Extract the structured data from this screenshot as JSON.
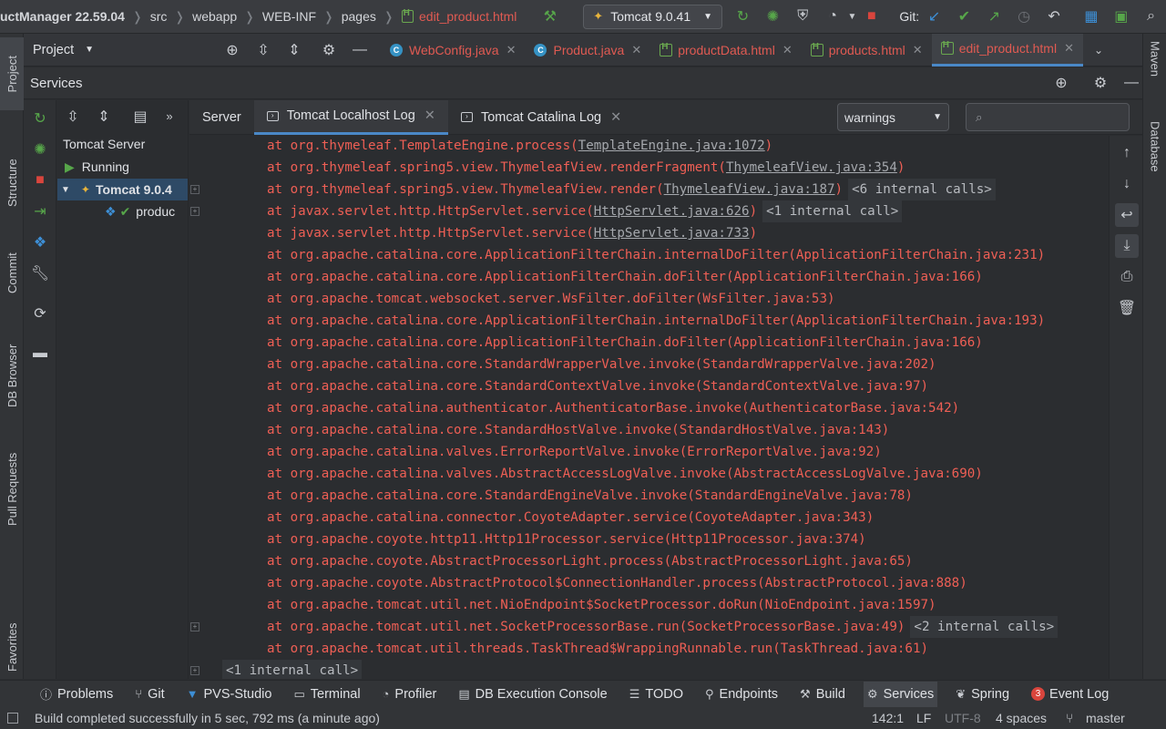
{
  "navbar": {
    "project": "uctManager 22.59.04",
    "crumbs": [
      "src",
      "webapp",
      "WEB-INF",
      "pages"
    ],
    "file": "edit_product.html",
    "run_config": "Tomcat 9.0.41",
    "git_label": "Git:"
  },
  "left_strip": {
    "project": "Project",
    "structure": "Structure",
    "commit": "Commit",
    "db_browser": "DB Browser",
    "pull_requests": "Pull Requests",
    "favorites": "Favorites"
  },
  "right_strip": {
    "maven": "Maven",
    "database": "Database"
  },
  "project_combo": "Project",
  "editor_tabs": [
    {
      "label": "WebConfig.java",
      "type": "java"
    },
    {
      "label": "Product.java",
      "type": "java"
    },
    {
      "label": "productData.html",
      "type": "html"
    },
    {
      "label": "products.html",
      "type": "html"
    },
    {
      "label": "edit_product.html",
      "type": "html"
    }
  ],
  "services": {
    "title": "Services",
    "tree": {
      "group": "Tomcat Server",
      "status": "Running",
      "server": "Tomcat 9.0.4",
      "artifact": "produc"
    },
    "log_tabs": [
      "Server",
      "Tomcat Localhost Log",
      "Tomcat Catalina Log"
    ],
    "filter": "warnings",
    "search_placeholder": ""
  },
  "console": {
    "lines": [
      {
        "pre": "at org.thymeleaf.TemplateEngine.process(",
        "link": "TemplateEngine.java:1072",
        "post": ")",
        "hint": ""
      },
      {
        "pre": "at org.thymeleaf.spring5.view.ThymeleafView.renderFragment(",
        "link": "ThymeleafView.java:354",
        "post": ")",
        "hint": ""
      },
      {
        "pre": "at org.thymeleaf.spring5.view.ThymeleafView.render(",
        "link": "ThymeleafView.java:187",
        "post": ")",
        "hint": "<6 internal calls>"
      },
      {
        "pre": "at javax.servlet.http.HttpServlet.service(",
        "link": "HttpServlet.java:626",
        "post": ")",
        "hint": "<1 internal call>"
      },
      {
        "pre": "at javax.servlet.http.HttpServlet.service(",
        "link": "HttpServlet.java:733",
        "post": ")",
        "hint": ""
      },
      {
        "pre": "at org.apache.catalina.core.ApplicationFilterChain.internalDoFilter(ApplicationFilterChain.java:231)",
        "link": "",
        "post": "",
        "hint": ""
      },
      {
        "pre": "at org.apache.catalina.core.ApplicationFilterChain.doFilter(ApplicationFilterChain.java:166)",
        "link": "",
        "post": "",
        "hint": ""
      },
      {
        "pre": "at org.apache.tomcat.websocket.server.WsFilter.doFilter(WsFilter.java:53)",
        "link": "",
        "post": "",
        "hint": ""
      },
      {
        "pre": "at org.apache.catalina.core.ApplicationFilterChain.internalDoFilter(ApplicationFilterChain.java:193)",
        "link": "",
        "post": "",
        "hint": ""
      },
      {
        "pre": "at org.apache.catalina.core.ApplicationFilterChain.doFilter(ApplicationFilterChain.java:166)",
        "link": "",
        "post": "",
        "hint": ""
      },
      {
        "pre": "at org.apache.catalina.core.StandardWrapperValve.invoke(StandardWrapperValve.java:202)",
        "link": "",
        "post": "",
        "hint": ""
      },
      {
        "pre": "at org.apache.catalina.core.StandardContextValve.invoke(StandardContextValve.java:97)",
        "link": "",
        "post": "",
        "hint": ""
      },
      {
        "pre": "at org.apache.catalina.authenticator.AuthenticatorBase.invoke(AuthenticatorBase.java:542)",
        "link": "",
        "post": "",
        "hint": ""
      },
      {
        "pre": "at org.apache.catalina.core.StandardHostValve.invoke(StandardHostValve.java:143)",
        "link": "",
        "post": "",
        "hint": ""
      },
      {
        "pre": "at org.apache.catalina.valves.ErrorReportValve.invoke(ErrorReportValve.java:92)",
        "link": "",
        "post": "",
        "hint": ""
      },
      {
        "pre": "at org.apache.catalina.valves.AbstractAccessLogValve.invoke(AbstractAccessLogValve.java:690)",
        "link": "",
        "post": "",
        "hint": ""
      },
      {
        "pre": "at org.apache.catalina.core.StandardEngineValve.invoke(StandardEngineValve.java:78)",
        "link": "",
        "post": "",
        "hint": ""
      },
      {
        "pre": "at org.apache.catalina.connector.CoyoteAdapter.service(CoyoteAdapter.java:343)",
        "link": "",
        "post": "",
        "hint": ""
      },
      {
        "pre": "at org.apache.coyote.http11.Http11Processor.service(Http11Processor.java:374)",
        "link": "",
        "post": "",
        "hint": ""
      },
      {
        "pre": "at org.apache.coyote.AbstractProcessorLight.process(AbstractProcessorLight.java:65)",
        "link": "",
        "post": "",
        "hint": ""
      },
      {
        "pre": "at org.apache.coyote.AbstractProtocol$ConnectionHandler.process(AbstractProtocol.java:888)",
        "link": "",
        "post": "",
        "hint": ""
      },
      {
        "pre": "at org.apache.tomcat.util.net.NioEndpoint$SocketProcessor.doRun(NioEndpoint.java:1597)",
        "link": "",
        "post": "",
        "hint": ""
      },
      {
        "pre": "at org.apache.tomcat.util.net.SocketProcessorBase.run(SocketProcessorBase.java:49)",
        "link": "",
        "post": "",
        "hint": "<2 internal calls>"
      },
      {
        "pre": "at org.apache.tomcat.util.threads.TaskThread$WrappingRunnable.run(TaskThread.java:61)",
        "link": "",
        "post": "",
        "hint": ""
      }
    ],
    "last_hint": "<1 internal call>"
  },
  "bottom_tools": [
    {
      "label": "Problems",
      "icon": "problems-icon",
      "active": false
    },
    {
      "label": "Git",
      "icon": "git-icon",
      "active": false
    },
    {
      "label": "PVS-Studio",
      "icon": "pvs-icon",
      "active": false
    },
    {
      "label": "Terminal",
      "icon": "terminal-icon",
      "active": false
    },
    {
      "label": "Profiler",
      "icon": "profiler-icon",
      "active": false
    },
    {
      "label": "DB Execution Console",
      "icon": "db-console-icon",
      "active": false
    },
    {
      "label": "TODO",
      "icon": "todo-icon",
      "active": false
    },
    {
      "label": "Endpoints",
      "icon": "endpoints-icon",
      "active": false
    },
    {
      "label": "Build",
      "icon": "build-icon",
      "active": false
    },
    {
      "label": "Services",
      "icon": "services-icon",
      "active": true
    },
    {
      "label": "Spring",
      "icon": "spring-icon",
      "active": false
    },
    {
      "label": "Event Log",
      "icon": "event-log-icon",
      "active": false,
      "badge": "3"
    }
  ],
  "status": {
    "message": "Build completed successfully in 5 sec, 792 ms (a minute ago)",
    "position": "142:1",
    "line_sep": "LF",
    "encoding": "UTF-8",
    "indent": "4 spaces",
    "branch": "master"
  },
  "colors": {
    "error_text": "#ef5f55",
    "accent": "#4a88c7",
    "run_green": "#57a64a"
  }
}
